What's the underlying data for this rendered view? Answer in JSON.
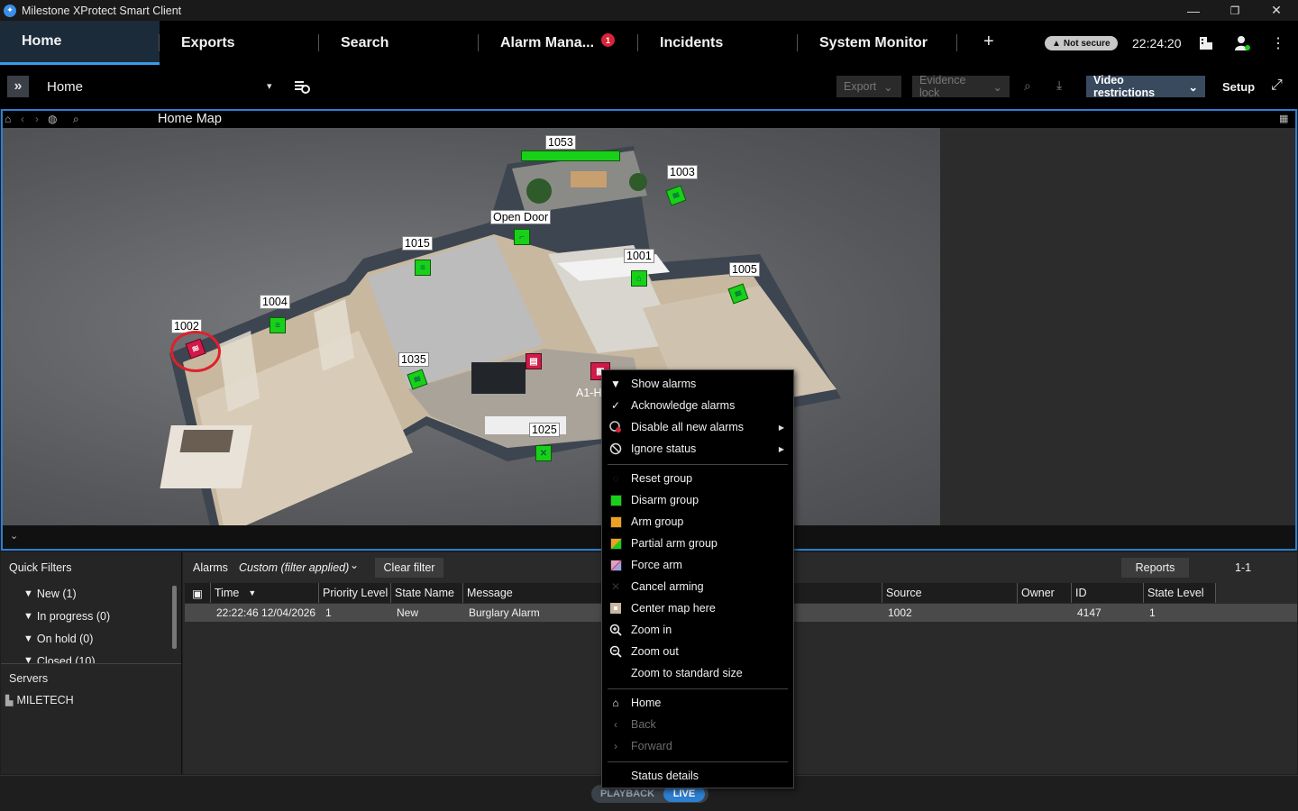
{
  "window": {
    "title": "Milestone XProtect Smart Client"
  },
  "tabs": [
    {
      "label": "Home",
      "active": true
    },
    {
      "label": "Exports"
    },
    {
      "label": "Search"
    },
    {
      "label": "Alarm Mana...",
      "badge": "1"
    },
    {
      "label": "Incidents"
    },
    {
      "label": "System Monitor"
    }
  ],
  "header": {
    "not_secure": "Not secure",
    "clock": "22:24:20"
  },
  "toolbar": {
    "view_name": "Home",
    "export_label": "Export",
    "evidence_lock_label": "Evidence lock",
    "video_restrictions_label": "Video restrictions",
    "setup_label": "Setup"
  },
  "map": {
    "title": "Home Map",
    "labels": {
      "l1053": "1053",
      "l1003": "1003",
      "open_door": "Open Door",
      "l1015": "1015",
      "l1001": "1001",
      "l1005": "1005",
      "l1004": "1004",
      "l1002": "1002",
      "l1035": "1035",
      "a1h": "A1-H",
      "l1025": "1025"
    }
  },
  "context_menu": {
    "items": [
      {
        "label": "Show alarms",
        "icon": "filter-icon"
      },
      {
        "label": "Acknowledge alarms",
        "icon": "checkmark-icon"
      },
      {
        "label": "Disable all new alarms",
        "icon": "disable-alarm-icon",
        "submenu": true
      },
      {
        "label": "Ignore status",
        "icon": "no-icon",
        "submenu": true
      },
      {
        "label": "Reset group",
        "icon": "reset-icon"
      },
      {
        "label": "Disarm group",
        "icon": "green-swatch-icon"
      },
      {
        "label": "Arm group",
        "icon": "orange-swatch-icon"
      },
      {
        "label": "Partial arm group",
        "icon": "partial-swatch-icon"
      },
      {
        "label": "Force arm",
        "icon": "force-arm-icon"
      },
      {
        "label": "Cancel arming",
        "icon": "cancel-icon"
      },
      {
        "label": "Center map here",
        "icon": "center-map-icon"
      },
      {
        "label": "Zoom in",
        "icon": "zoom-in-icon"
      },
      {
        "label": "Zoom out",
        "icon": "zoom-out-icon"
      },
      {
        "label": "Zoom to standard size",
        "icon": ""
      },
      {
        "label": "Home",
        "icon": "home-icon"
      },
      {
        "label": "Back",
        "icon": "back-icon",
        "disabled": true
      },
      {
        "label": "Forward",
        "icon": "forward-icon",
        "disabled": true
      },
      {
        "label": "Status details",
        "icon": ""
      }
    ]
  },
  "quick_filters": {
    "title": "Quick Filters",
    "items": [
      "New (1)",
      "In progress (0)",
      "On hold (0)",
      "Closed (10)"
    ],
    "servers_title": "Servers",
    "server": "MILETECH"
  },
  "alarms": {
    "title": "Alarms",
    "filter_state": "Custom (filter applied)",
    "clear_filter": "Clear filter",
    "reports": "Reports",
    "page": "1-1",
    "columns": [
      "Time",
      "Priority Level",
      "State Name",
      "Message",
      "Source",
      "Owner",
      "ID",
      "State Level"
    ],
    "rows": [
      {
        "time": "22:22:46 12/04/2026",
        "priority": "1",
        "state": "New",
        "message": "Burglary Alarm",
        "source": "1002",
        "owner": "",
        "id": "4147",
        "state_level": "1"
      }
    ]
  },
  "status": {
    "playback": "PLAYBACK",
    "live": "LIVE"
  },
  "colors": {
    "accent": "#2d7fd0",
    "badge": "#d9233b",
    "sensor_ok": "#19d019",
    "sensor_alarm": "#d1194a"
  }
}
